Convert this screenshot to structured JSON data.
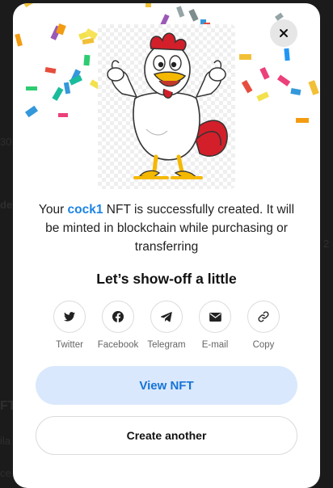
{
  "modal": {
    "close_icon": "close-icon",
    "nft_image_alt": "Cartoon rooster giving two thumbs up",
    "message": {
      "prefix": "Your ",
      "nft_name": "cock1",
      "suffix": " NFT is successfully created. It will be minted in blockchain while purchasing or transferring"
    },
    "heading": "Let’s show-off a little",
    "share": [
      {
        "label": "Twitter",
        "icon": "twitter-icon"
      },
      {
        "label": "Facebook",
        "icon": "facebook-icon"
      },
      {
        "label": "Telegram",
        "icon": "telegram-icon"
      },
      {
        "label": "E-mail",
        "icon": "email-icon"
      },
      {
        "label": "Copy",
        "icon": "link-icon"
      }
    ],
    "view_nft_label": "View NFT",
    "create_another_label": "Create another"
  },
  "colors": {
    "accent": "#1d83e6",
    "primary_button_bg": "#d9e8fc",
    "primary_button_text": "#1673d6",
    "overlay": "#1b1b1b"
  }
}
